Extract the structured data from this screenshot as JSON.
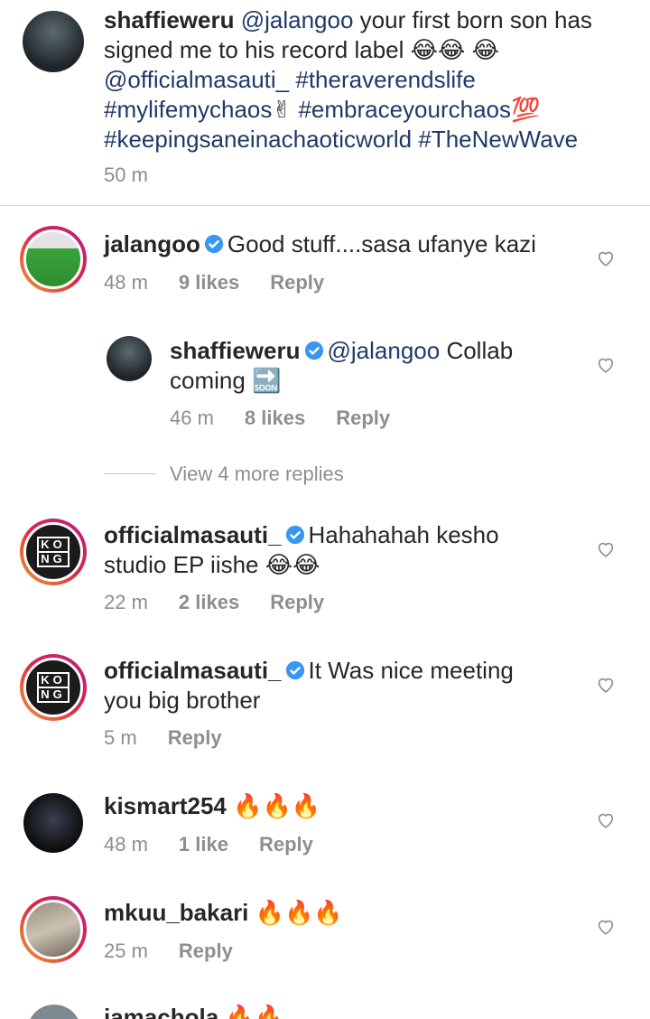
{
  "caption": {
    "username": "shaffieweru",
    "mention": "@jalangoo",
    "text1": " your first born son has signed me to his record label ",
    "emoji1": "😂😂",
    "emoji2": "😂",
    "mention2": "@officialmasauti_",
    "tag1": "#theraverendslife",
    "tag2": "#mylifemychaos",
    "emoji3": "✌",
    "tag3": "#embraceyourchaos",
    "emoji4": "💯",
    "tag4": "#keepingsaneinachaoticworld",
    "tag5": "#TheNewWave",
    "time": "50 m"
  },
  "comments": [
    {
      "username": "jalangoo",
      "text": "Good stuff....sasa ufanye kazi",
      "time": "48 m",
      "likes": "9 likes",
      "reply": "Reply"
    },
    {
      "username": "shaffieweru",
      "mention": "@jalangoo",
      "text1": " Collab",
      "text2": "coming ",
      "emoji": "🔜",
      "time": "46 m",
      "likes": "8 likes",
      "reply": "Reply"
    },
    {
      "view_more": "View 4 more replies"
    },
    {
      "username": "officialmasauti_",
      "text1": "Hahahahah kesho",
      "text2": "studio EP iishe ",
      "emoji": "😂😂",
      "time": "22 m",
      "likes": "2 likes",
      "reply": "Reply"
    },
    {
      "username": "officialmasauti_",
      "text1": "It Was nice meeting",
      "text2": "you big brother",
      "time": "5 m",
      "reply": "Reply"
    },
    {
      "username": "kismart254",
      "emoji": "🔥🔥🔥",
      "time": "48 m",
      "likes": "1 like",
      "reply": "Reply"
    },
    {
      "username": "mkuu_bakari",
      "emoji": "🔥🔥🔥",
      "time": "25 m",
      "reply": "Reply"
    },
    {
      "username": "jamachola",
      "emoji": "🔥🔥"
    }
  ],
  "kong_avatar": {
    "line1": "KO",
    "line2": "NG"
  },
  "colors": {
    "link": "#1f3a68",
    "meta": "#8e8e8e",
    "verified": "#3897f0"
  }
}
